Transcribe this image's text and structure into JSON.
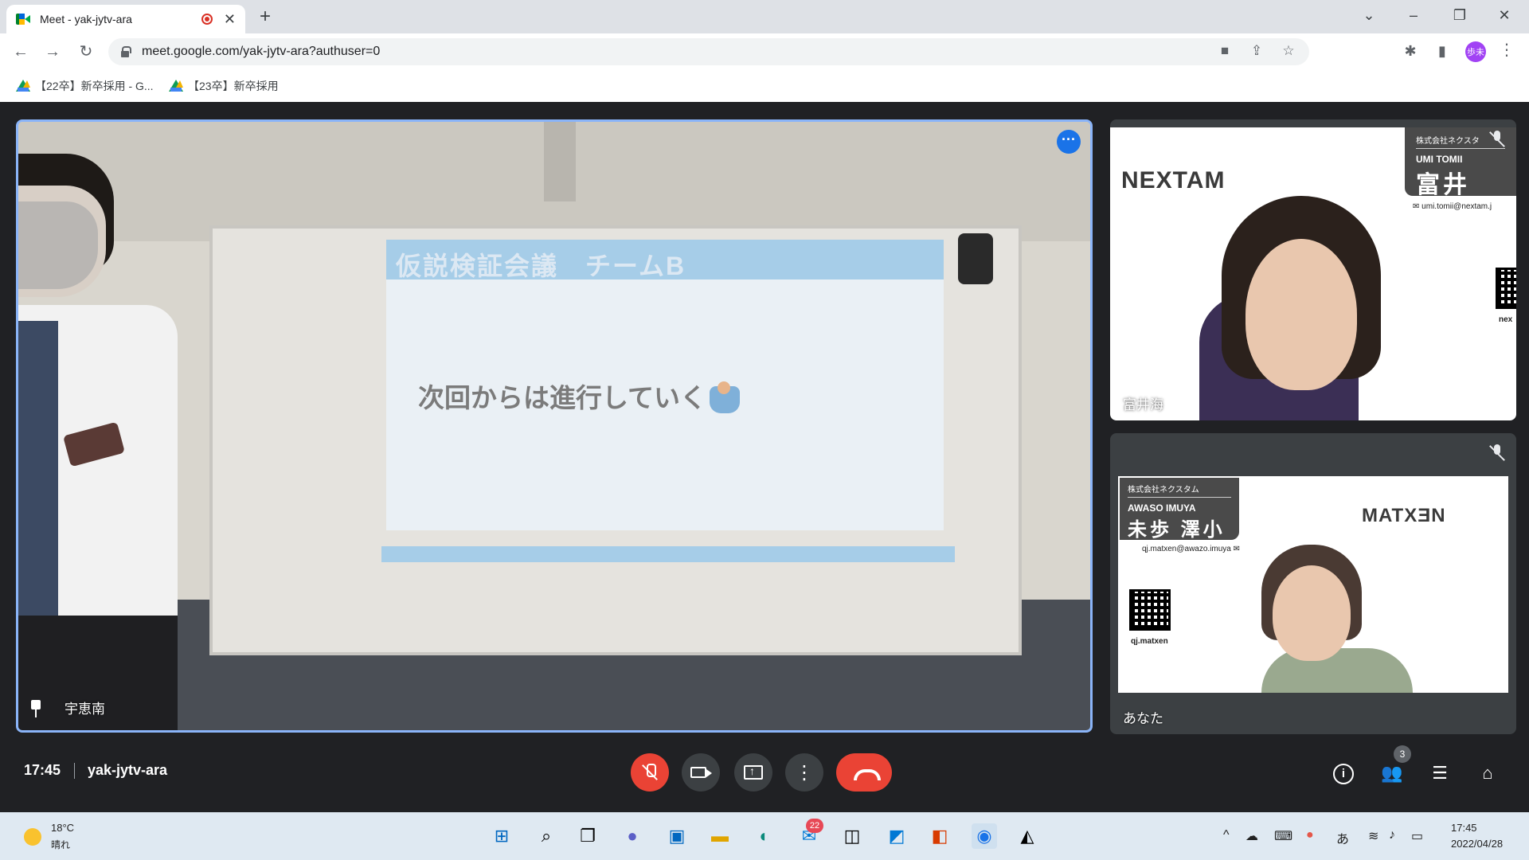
{
  "browser": {
    "tab_title": "Meet - yak-jytv-ara",
    "url": "meet.google.com/yak-jytv-ara?authuser=0",
    "profile_initials": "歩未",
    "bookmarks": [
      {
        "label": "【22卒】新卒採用 - G..."
      },
      {
        "label": "【23卒】新卒採用"
      }
    ]
  },
  "meet": {
    "main_tile": {
      "participant_name": "宇恵南",
      "slide_title": "仮説検証会議　チームB",
      "slide_text": "次回からは進行していく"
    },
    "side_tiles": [
      {
        "participant_name": "富井海",
        "logo": "NEXTAM",
        "card_company": "株式会社ネクスタ",
        "card_name_en": "UMI TOMII",
        "card_name_jp": "富井 海",
        "card_email": "umi.tomii@nextam.j",
        "qr_caption": "nex"
      },
      {
        "participant_name": "あなた",
        "logo": "MATXƎN",
        "card_company": "株式会社ネクスタム",
        "card_name_en": "AWASO IMUYA",
        "card_name_jp": "未歩 澤小",
        "card_email": "qj.matxen@awazo.imuya",
        "qr_caption": "qj.matxen"
      }
    ],
    "bottom_bar": {
      "time": "17:45",
      "meeting_code": "yak-jytv-ara",
      "people_count": "3"
    }
  },
  "taskbar": {
    "weather_temp": "18°C",
    "weather_desc": "晴れ",
    "mail_badge": "22",
    "ime_indicator": "あ",
    "time": "17:45",
    "date": "2022/04/28"
  },
  "colors": {
    "accent": "#8ab4f8",
    "end_call": "#ea4335",
    "meet_bg": "#202124"
  }
}
